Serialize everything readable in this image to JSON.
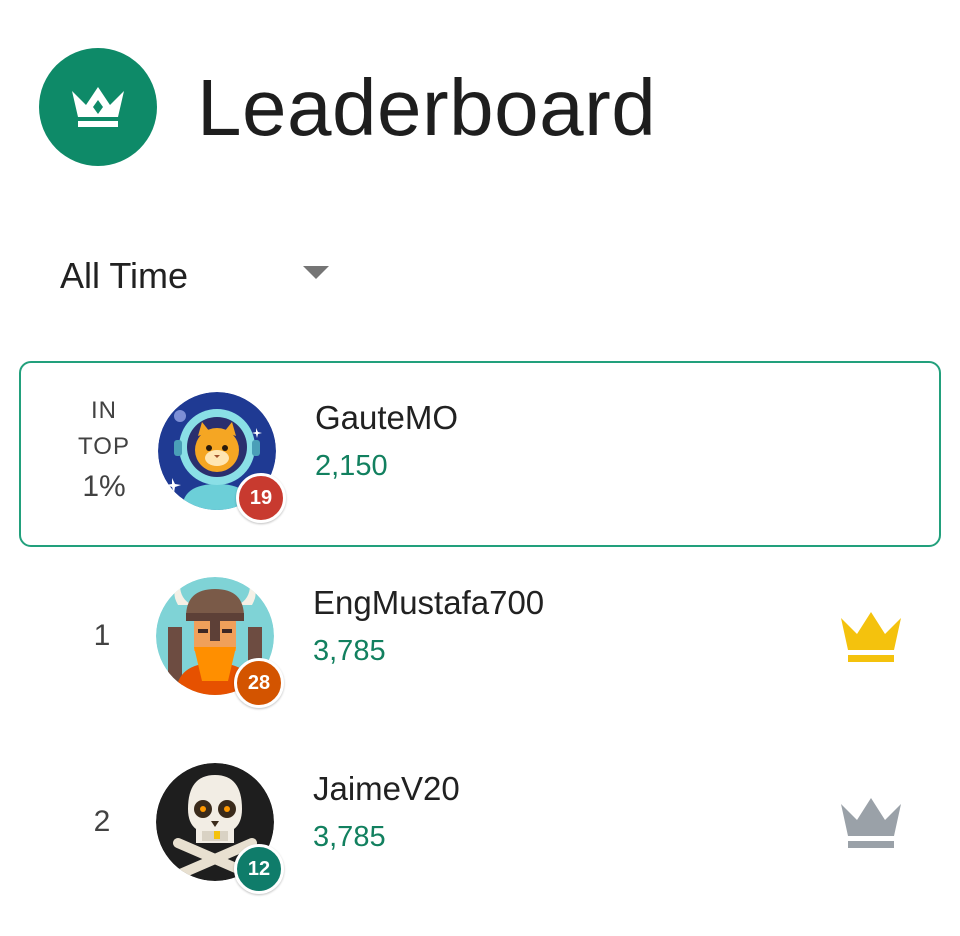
{
  "header": {
    "title": "Leaderboard",
    "icon": "crown-icon",
    "badge_color": "#0e8a68"
  },
  "filter": {
    "selected": "All Time",
    "caret_icon": "dropdown-caret-icon"
  },
  "current_user": {
    "rank_line1": "IN",
    "rank_line2": "TOP",
    "rank_line3": "1%",
    "username": "GauteMO",
    "score": "2,150",
    "level": "19",
    "level_color": "#c83a2f",
    "avatar": "astronaut-cat-avatar",
    "highlight_color": "#22a07c"
  },
  "rows": [
    {
      "rank": "1",
      "username": "EngMustafa700",
      "score": "3,785",
      "level": "28",
      "level_color": "#d35400",
      "avatar": "viking-avatar",
      "crown_icon": "gold-crown-icon",
      "crown_color": "#f4c20d"
    },
    {
      "rank": "2",
      "username": "JaimeV20",
      "score": "3,785",
      "level": "12",
      "level_color": "#0f7c6a",
      "avatar": "skull-avatar",
      "crown_icon": "silver-crown-icon",
      "crown_color": "#9aa1a8"
    }
  ],
  "colors": {
    "score_text": "#12805f"
  }
}
